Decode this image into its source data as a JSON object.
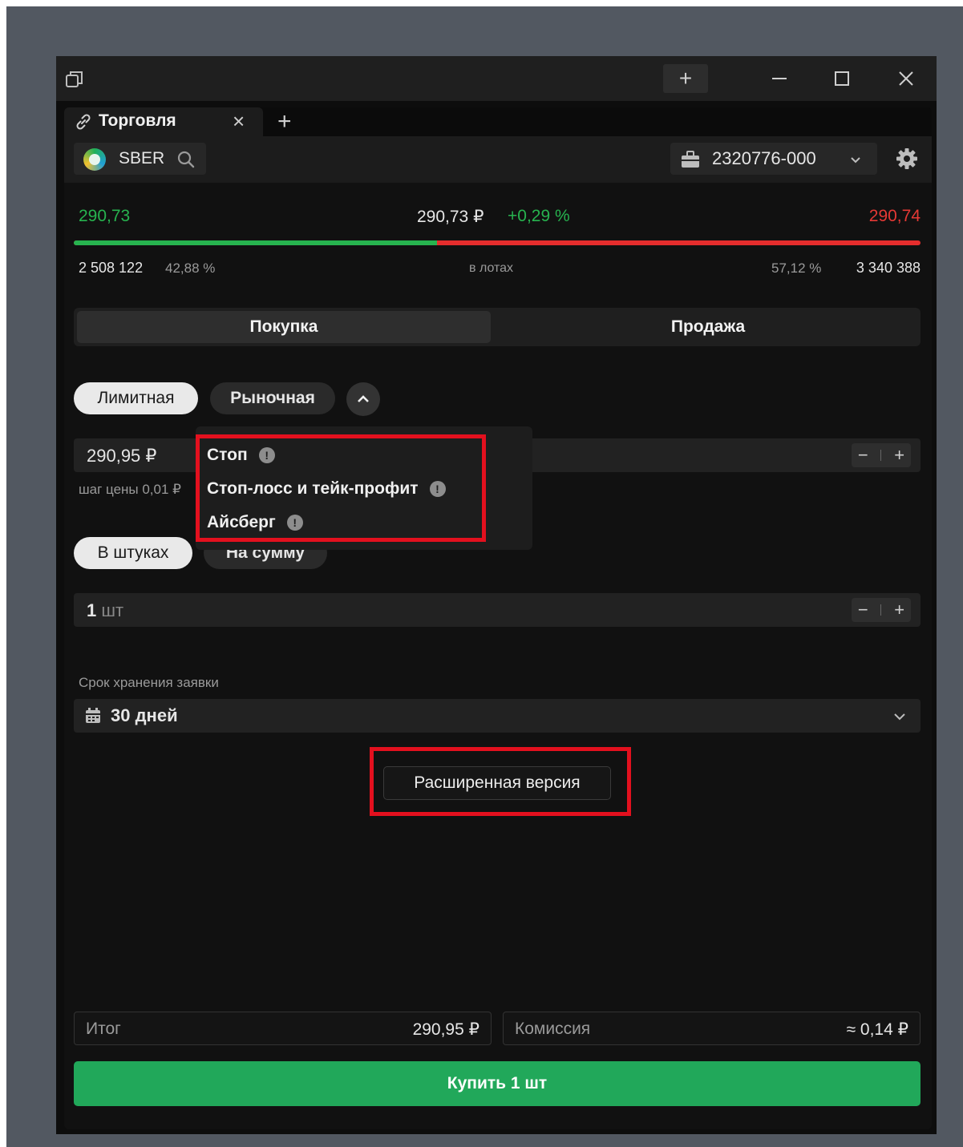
{
  "tab": {
    "title": "Торговля",
    "close_glyph": "×",
    "new_glyph": "+"
  },
  "window": {
    "add_glyph": "+"
  },
  "instrument": {
    "ticker": "SBER",
    "logo": "sber-logo"
  },
  "account": {
    "number": "2320776-000"
  },
  "quotes": {
    "bid": "290,73",
    "last": "290,73 ₽",
    "change": "+0,29 %",
    "ask": "290,74"
  },
  "depth": {
    "bid_volume": "2 508 122",
    "bid_percent": "42,88 %",
    "center_label": "в лотах",
    "ask_percent": "57,12 %",
    "ask_volume": "3 340 388",
    "bid_share": 0.4288
  },
  "side": {
    "buy": "Покупка",
    "sell": "Продажа"
  },
  "order_types": {
    "limit": "Лимитная",
    "market": "Рыночная"
  },
  "price": {
    "value": "290,95 ₽",
    "step": "шаг цены 0,01 ₽",
    "minus": "−",
    "plus": "+"
  },
  "dropdown": {
    "items": [
      {
        "label": "Стоп"
      },
      {
        "label": "Стоп-лосс и тейк-профит"
      },
      {
        "label": "Айсберг"
      }
    ],
    "info_glyph": "!"
  },
  "amount_mode": {
    "pieces": "В штуках",
    "sum": "На сумму"
  },
  "quantity": {
    "value": "1",
    "unit": " шт",
    "minus": "−",
    "plus": "+"
  },
  "expiry": {
    "label": "Срок хранения заявки",
    "value": "30 дней"
  },
  "extended_button": "Расширенная версия",
  "summary": {
    "total_label": "Итог",
    "total_value": "290,95 ₽",
    "fee_label": "Комиссия",
    "fee_value": "≈ 0,14 ₽"
  },
  "buy_button": "Купить 1 шт",
  "colors": {
    "green": "#27b34f",
    "red": "#e53935",
    "buy_button": "#21a85a",
    "highlight": "#e3101e"
  }
}
